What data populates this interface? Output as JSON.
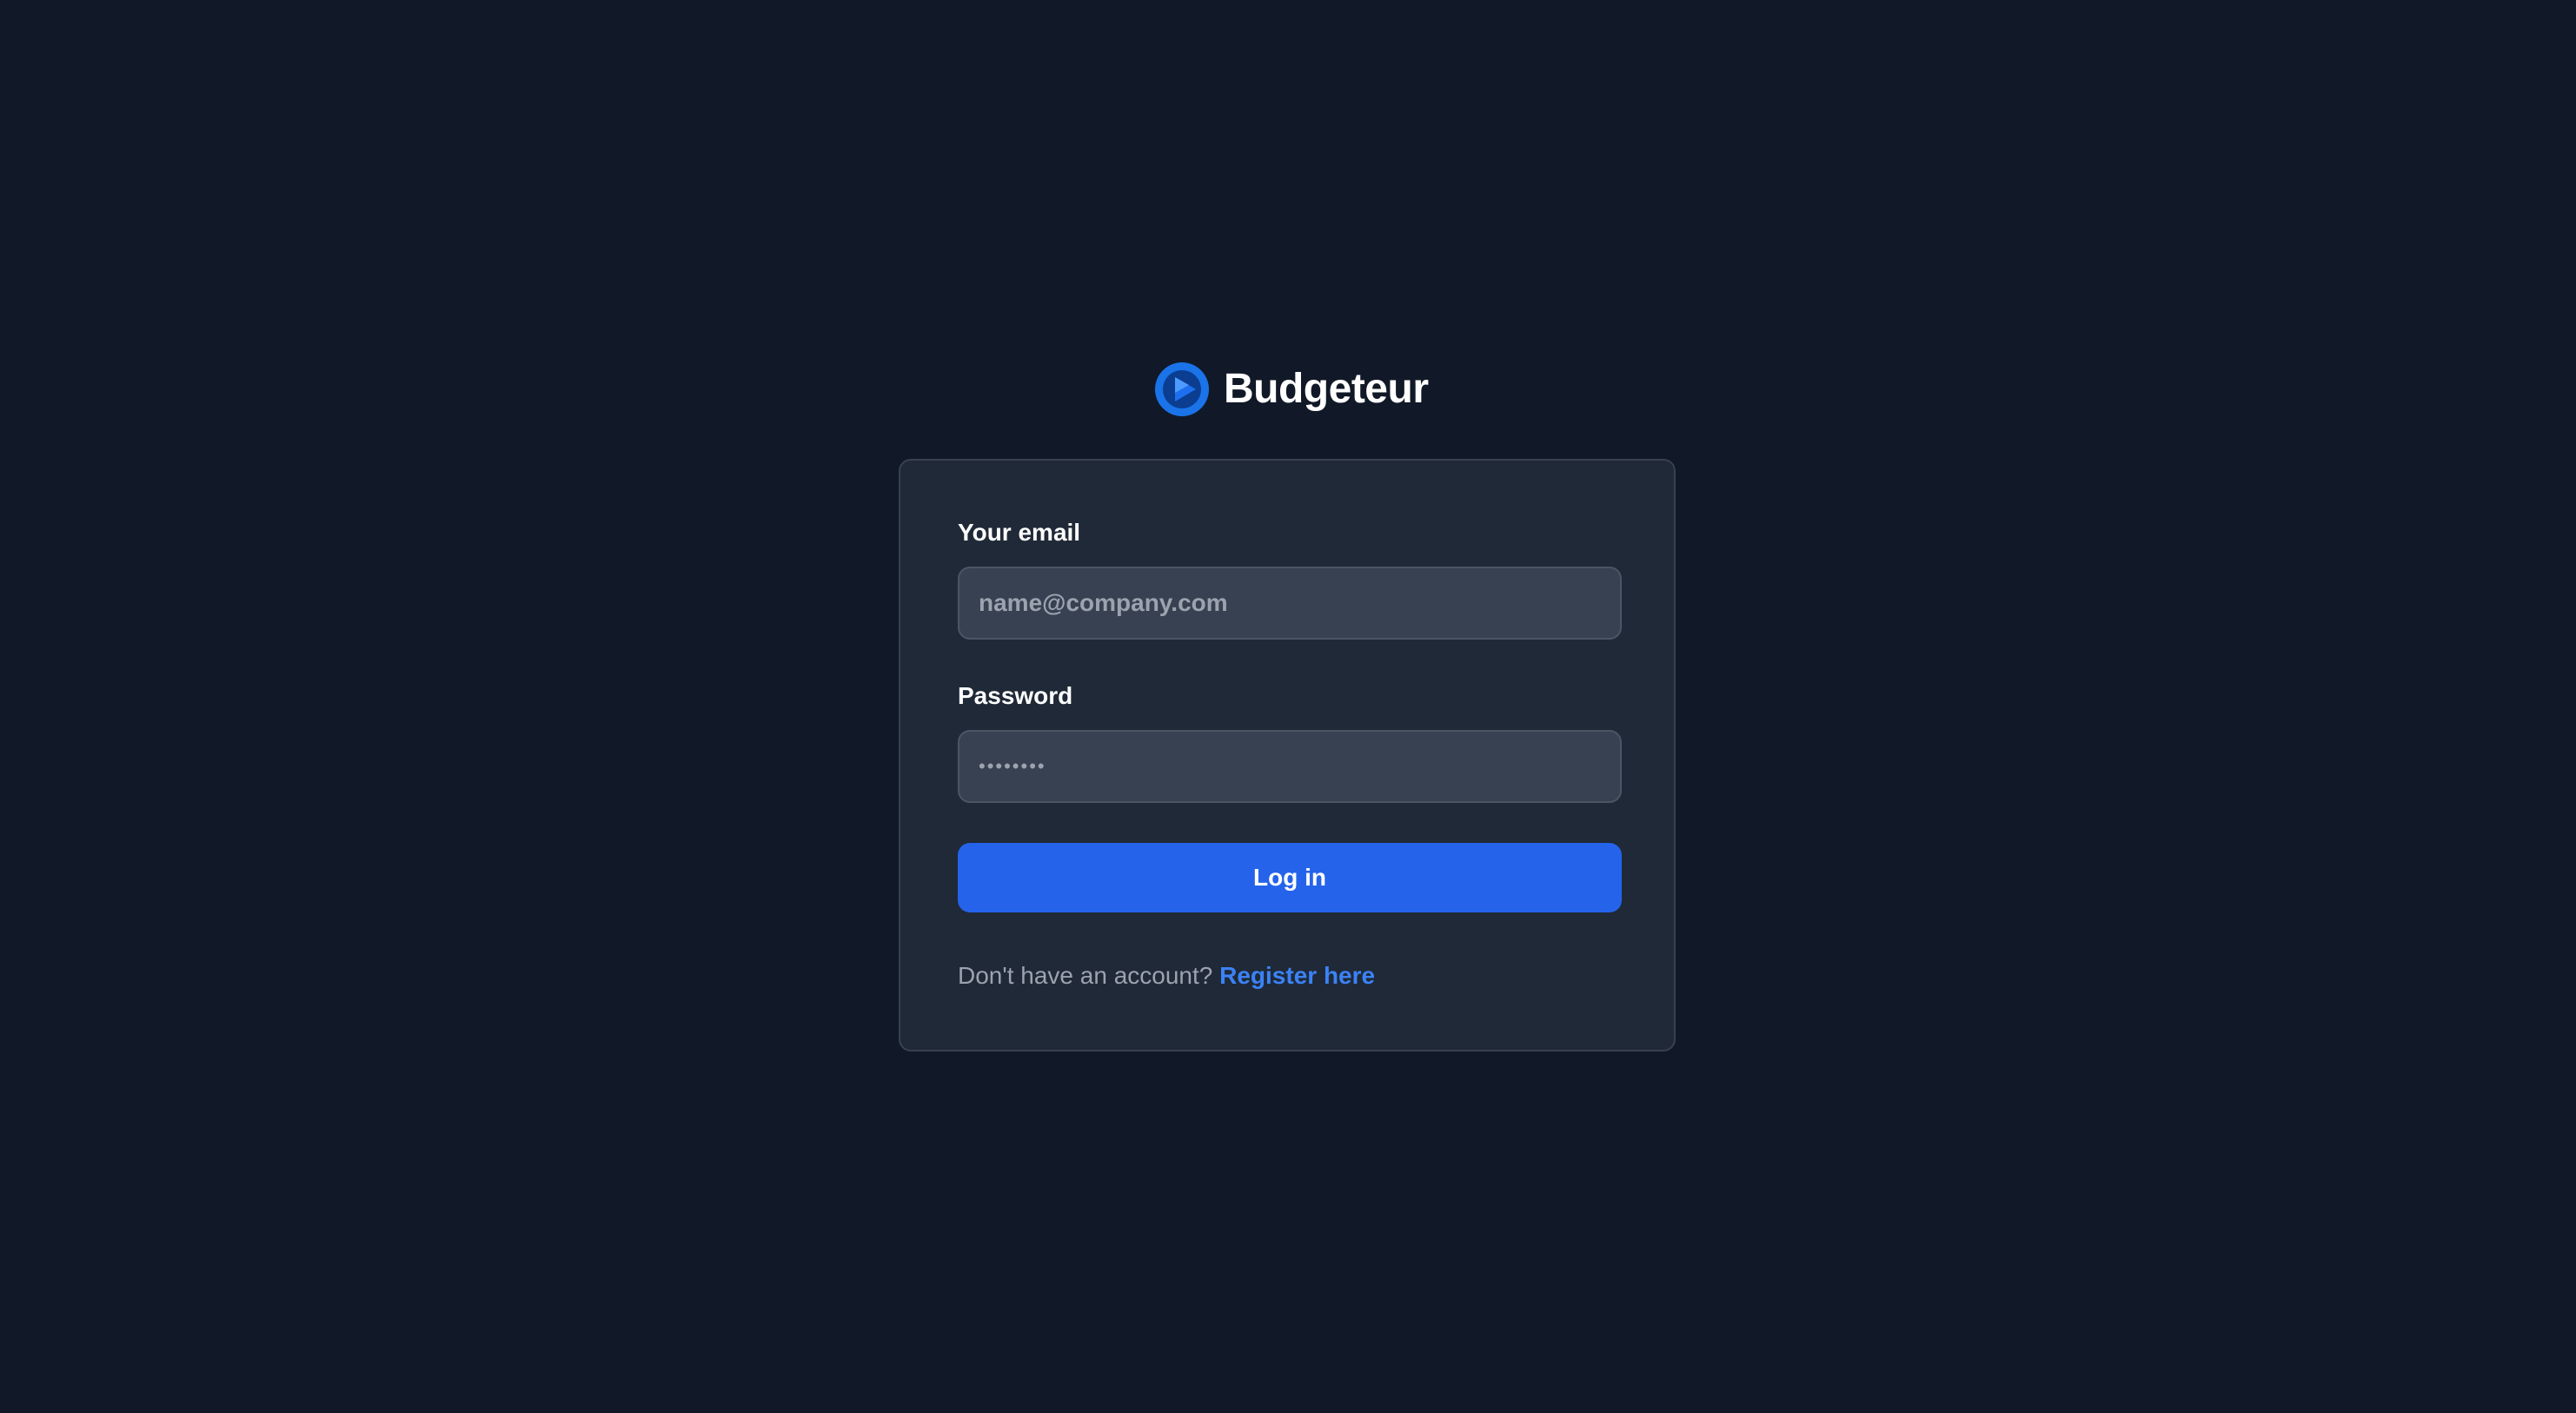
{
  "brand": {
    "name": "Budgeteur",
    "logo_icon": "budgeteur-play-logo-icon",
    "logo_color": "#1a73e8"
  },
  "login_form": {
    "email_label": "Your email",
    "email_placeholder": "name@company.com",
    "email_value": "",
    "password_label": "Password",
    "password_value": "••••••••",
    "submit_label": "Log in",
    "register_prompt": "Don't have an account?",
    "register_link": "Register here"
  },
  "colors": {
    "background": "#111827",
    "card": "#1f2937",
    "input": "#374151",
    "primary": "#2563eb",
    "link": "#3b82f6"
  }
}
